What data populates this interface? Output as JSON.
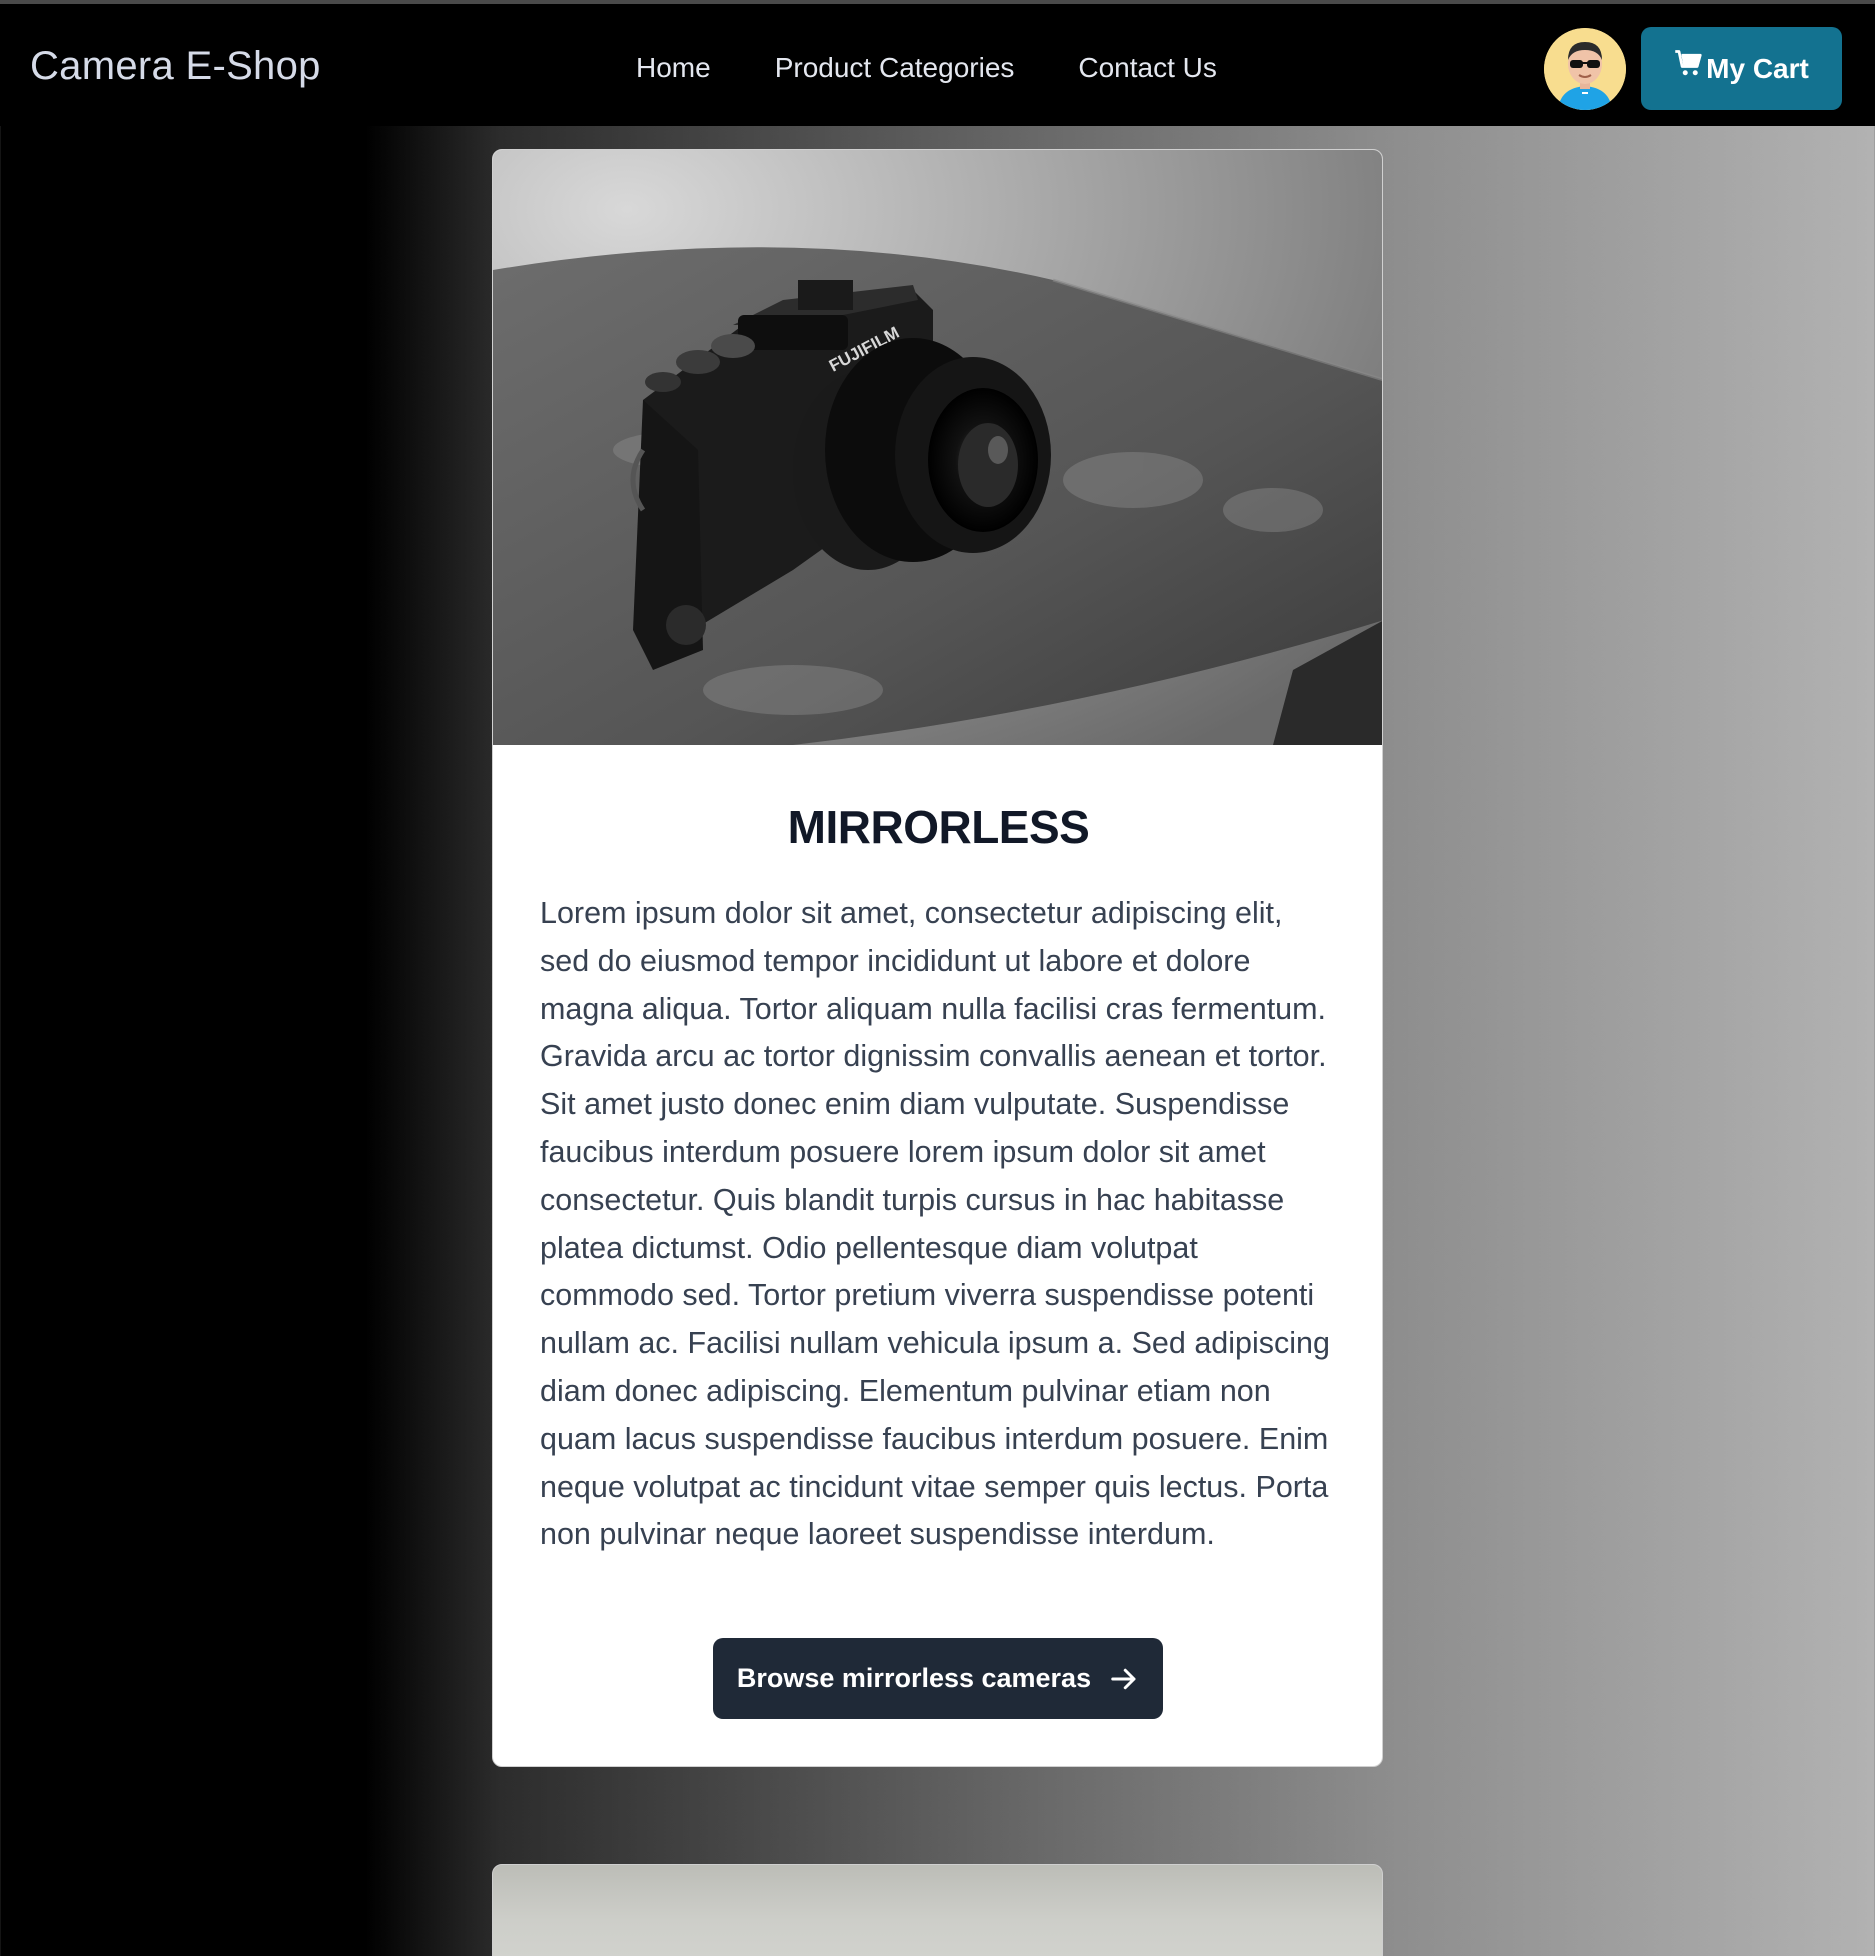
{
  "header": {
    "brand": "Camera E-Shop",
    "nav": [
      {
        "label": "Home"
      },
      {
        "label": "Product Categories"
      },
      {
        "label": "Contact Us"
      }
    ],
    "cart_label": "My Cart",
    "avatar_icon": "user-avatar-icon",
    "cart_icon": "shopping-cart-icon",
    "accent_color": "#137290"
  },
  "card": {
    "title": "MIRRORLESS",
    "description": "Lorem ipsum dolor sit amet, consectetur adipiscing elit, sed do eiusmod tempor incididunt ut labore et dolore magna aliqua. Tortor aliquam nulla facilisi cras fermentum. Gravida arcu ac tortor dignissim convallis aenean et tortor. Sit amet justo donec enim diam vulputate. Suspendisse faucibus interdum posuere lorem ipsum dolor sit amet consectetur. Quis blandit turpis cursus in hac habitasse platea dictumst. Odio pellentesque diam volutpat commodo sed. Tortor pretium viverra suspendisse potenti nullam ac. Facilisi nullam vehicula ipsum a. Sed adipiscing diam donec adipiscing. Elementum pulvinar etiam non quam lacus suspendisse faucibus interdum posuere. Enim neque volutpat ac tincidunt vitae semper quis lectus. Porta non pulvinar neque laoreet suspendisse interdum.",
    "button_label": "Browse mirrorless cameras",
    "button_icon": "arrow-right-icon",
    "image_icon": "camera-photo"
  }
}
